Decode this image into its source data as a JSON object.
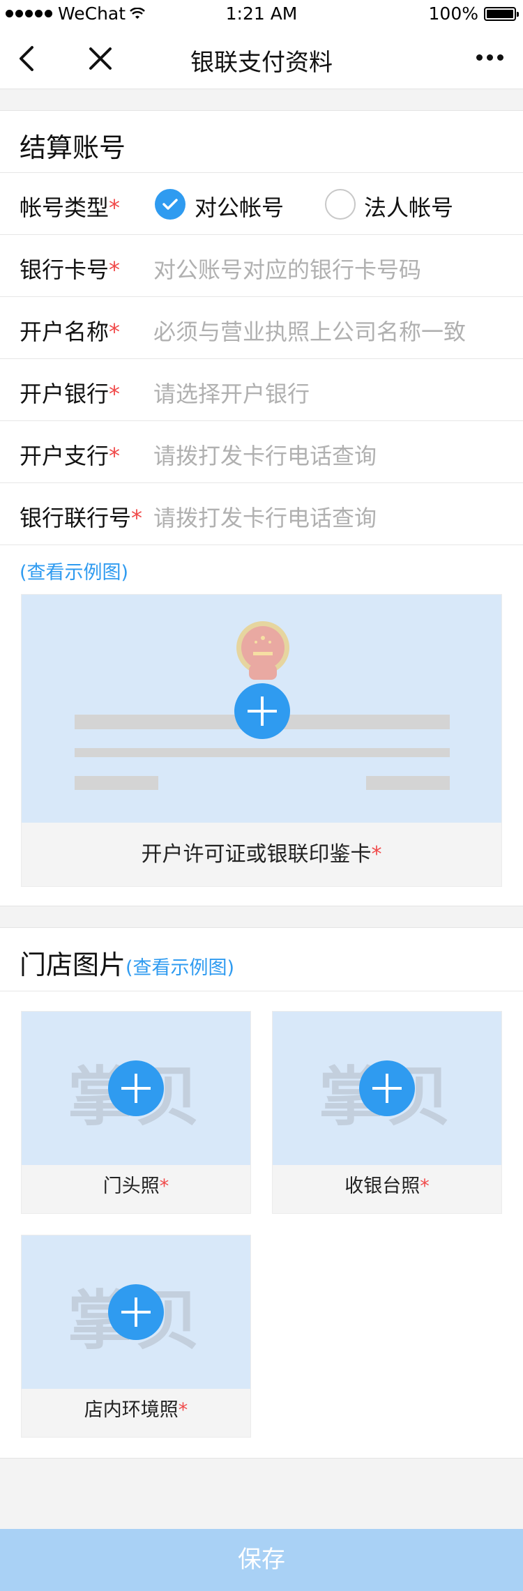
{
  "status_bar": {
    "carrier": "WeChat",
    "time": "1:21 AM",
    "battery": "100%"
  },
  "nav": {
    "title": "银联支付资料"
  },
  "settlement": {
    "title": "结算账号",
    "account_type": {
      "label": "帐号类型",
      "required": "*",
      "option_public": "对公帐号",
      "option_personal": "法人帐号",
      "selected": "对公帐号"
    },
    "bank_card": {
      "label": "银行卡号",
      "required": "*",
      "placeholder": "对公账号对应的银行卡号码"
    },
    "account_name": {
      "label": "开户名称",
      "required": "*",
      "placeholder": "必须与营业执照上公司名称一致"
    },
    "bank": {
      "label": "开户银行",
      "required": "*",
      "placeholder": "请选择开户银行"
    },
    "branch": {
      "label": "开户支行",
      "required": "*",
      "placeholder": "请拨打发卡行电话查询"
    },
    "union_no": {
      "label": "银行联行号",
      "required": "*",
      "placeholder": "请拨打发卡行电话查询"
    },
    "example_link": "(查看示例图)",
    "license_upload": {
      "caption": "开户许可证或银联印鉴卡",
      "required": "*"
    }
  },
  "store": {
    "title": "门店图片",
    "example_link": "(查看示例图)",
    "watermark": "掌贝",
    "tiles": [
      {
        "caption": "门头照",
        "required": "*"
      },
      {
        "caption": "收银台照",
        "required": "*"
      },
      {
        "caption": "店内环境照",
        "required": "*"
      }
    ]
  },
  "footer": {
    "save_label": "保存"
  },
  "colors": {
    "accent": "#2f9bf0",
    "required": "#f04a4a",
    "save_disabled": "#a9d1f5",
    "upload_bg": "#d8e8f9"
  }
}
